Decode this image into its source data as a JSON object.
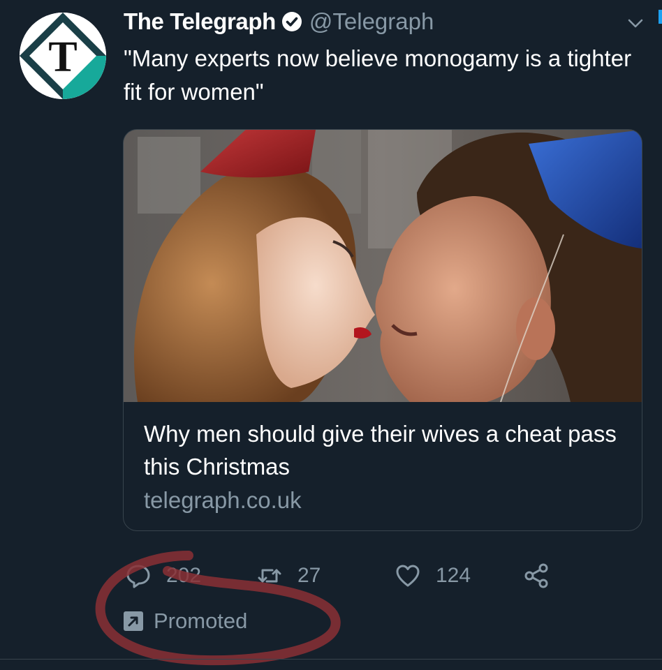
{
  "tweet": {
    "display_name": "The Telegraph",
    "handle": "@Telegraph",
    "verified_icon": "verified-badge-icon",
    "avatar_icon": "telegraph-t-logo",
    "text": "\"Many experts now believe monogamy is a tighter fit for women\""
  },
  "card": {
    "title": "Why men should give their wives a cheat pass this Christmas",
    "domain": "telegraph.co.uk"
  },
  "actions": {
    "reply": {
      "icon": "reply-bubble-icon",
      "count": "202"
    },
    "retweet": {
      "icon": "retweet-icon",
      "count": "27"
    },
    "like": {
      "icon": "heart-icon",
      "count": "124"
    },
    "share": {
      "icon": "share-icon"
    }
  },
  "promoted": {
    "icon": "promoted-arrow-icon",
    "label": "Promoted"
  },
  "colors": {
    "background": "#15202b",
    "muted_text": "#8899a6",
    "border": "#38444d",
    "accent": "#1da1f2",
    "logo_teal": "#17a99a",
    "annotation_red": "#8a3035"
  }
}
